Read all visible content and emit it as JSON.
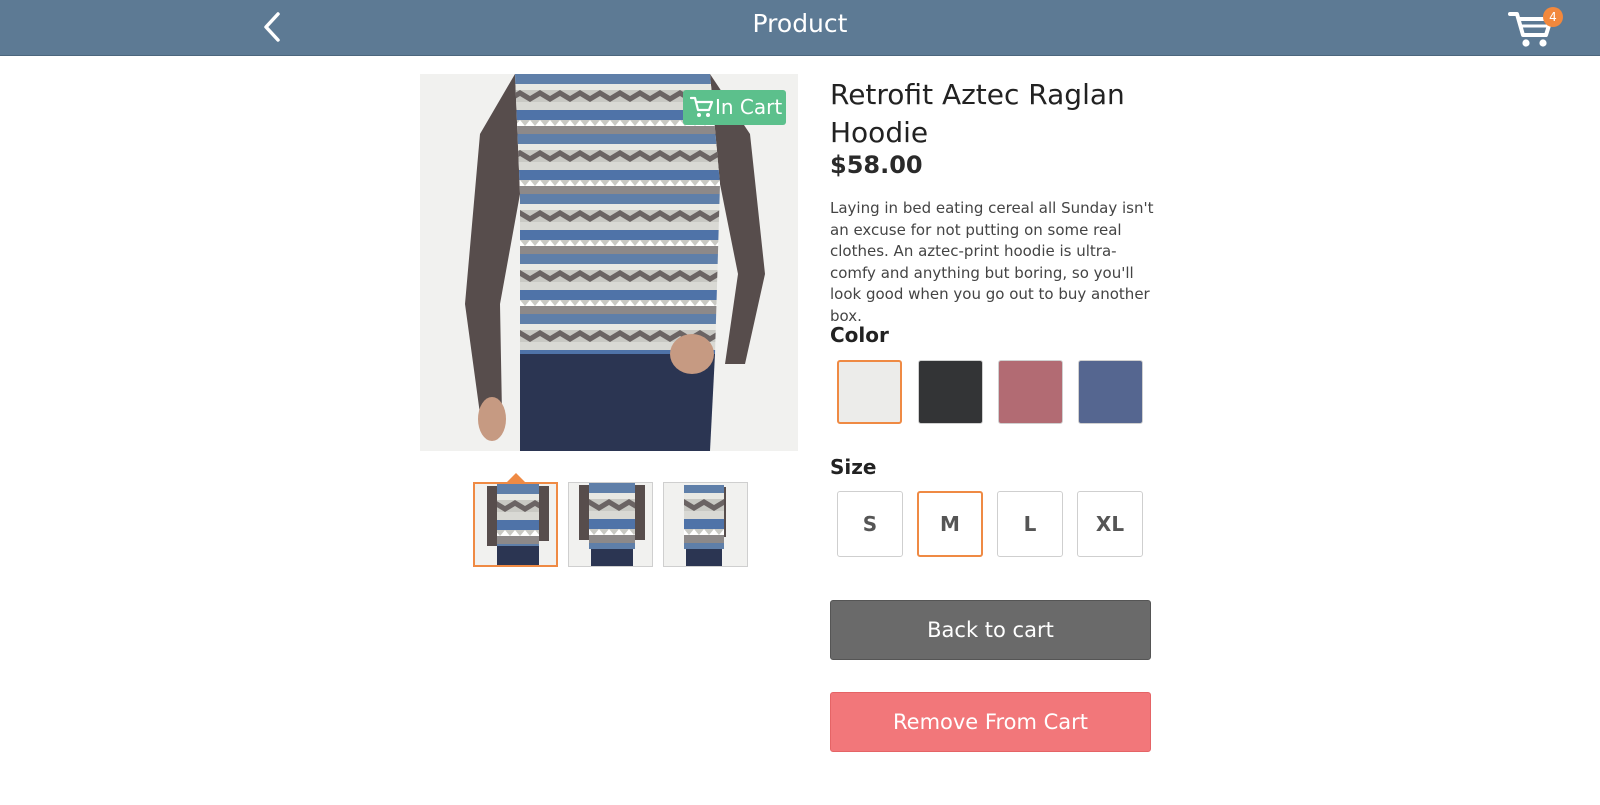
{
  "header": {
    "title": "Product",
    "cart_count": "4"
  },
  "product": {
    "name": "Retrofit Aztec Raglan Hoodie",
    "price": "$58.00",
    "description": "Laying in bed eating cereal all Sunday isn't an excuse for not putting on some real clothes. An aztec-print hoodie is ultra-comfy and anything but boring, so you'll look good when you go out to buy another box.",
    "badge": "In Cart"
  },
  "options": {
    "color_label": "Color",
    "size_label": "Size",
    "colors": [
      "#ececea",
      "#333436",
      "#b26b73",
      "#556690"
    ],
    "selected_color_index": 0,
    "sizes": [
      "S",
      "M",
      "L",
      "XL"
    ],
    "selected_size": "M"
  },
  "thumbnails": {
    "count": 3,
    "selected_index": 0
  },
  "actions": {
    "back_to_cart": "Back to cart",
    "remove_from_cart": "Remove From Cart"
  },
  "colors": {
    "header_bg": "#5d7a94",
    "accent": "#ef8a44",
    "in_cart_badge": "#5cc08c",
    "remove_button": "#f2777a",
    "back_button": "#6a6a6a"
  },
  "icons": [
    "chevron-left-icon",
    "cart-icon",
    "cart-small-icon"
  ]
}
